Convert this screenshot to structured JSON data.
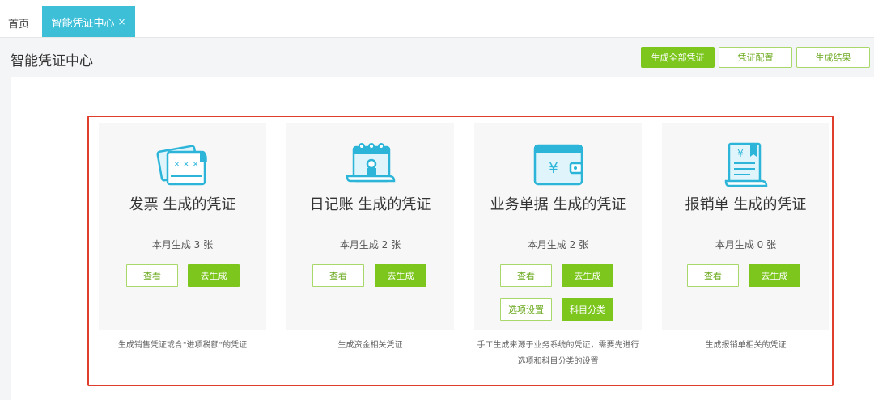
{
  "tabs": {
    "home_label": "首页",
    "active_label": "智能凭证中心",
    "close_glyph": "×"
  },
  "header": {
    "title": "智能凭证中心",
    "buttons": [
      "生成全部凭证",
      "凭证配置",
      "生成结果"
    ]
  },
  "cards": [
    {
      "title": "发票 生成的凭证",
      "count": "本月生成 3 张",
      "buttons": [
        "查看",
        "去生成"
      ],
      "description": "生成销售凭证或含\"进项税额\"的凭证"
    },
    {
      "title": "日记账 生成的凭证",
      "count": "本月生成 2 张",
      "buttons": [
        "查看",
        "去生成"
      ],
      "description": "生成资金相关凭证"
    },
    {
      "title": "业务单据 生成的凭证",
      "count": "本月生成  2 张",
      "buttons": [
        "查看",
        "去生成",
        "选项设置",
        "科目分类"
      ],
      "description_lines": [
        "手工生成来源于业务系统的凭证，需要先进行",
        "选项和科目分类的设置"
      ]
    },
    {
      "title": "报销单 生成的凭证",
      "count": "本月生成  0 张",
      "buttons": [
        "查看",
        "去生成"
      ],
      "description": "生成报销单相关的凭证"
    }
  ],
  "icons": {
    "currency_glyph": "¥",
    "stamp_glyph": "× × ×"
  },
  "colors": {
    "accent_green": "#7cc61e",
    "tab_teal": "#3dbfd8",
    "highlight_red": "#e03e2d",
    "icon_teal": "#2cb5d8"
  }
}
